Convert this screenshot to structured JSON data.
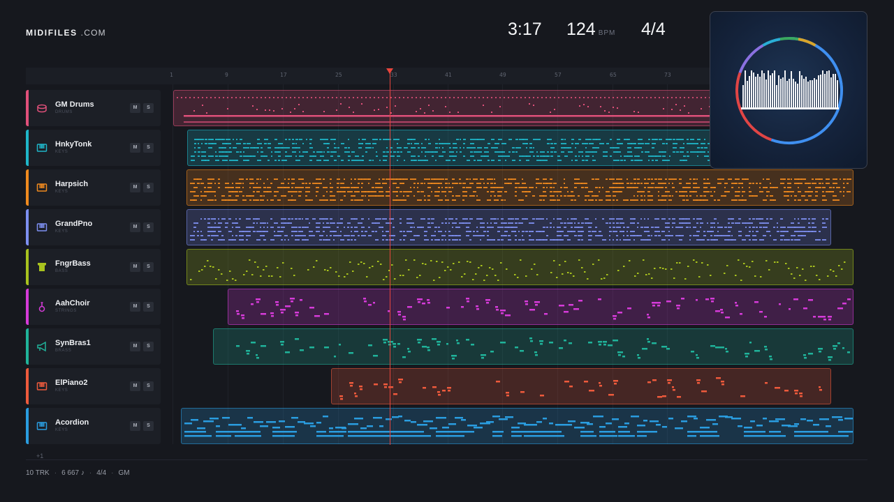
{
  "brand": {
    "name": "MIDIFILES",
    "suffix": ".COM"
  },
  "transport": {
    "time": "3:17",
    "bpm": "124",
    "bpm_unit": "BPM",
    "signature": "4/4"
  },
  "ruler": {
    "ticks": [
      "1",
      "9",
      "17",
      "25",
      "33",
      "41",
      "49",
      "57",
      "65",
      "73"
    ]
  },
  "tracks": [
    {
      "name": "GM Drums",
      "category": "DRUMS",
      "color": "#e0507a",
      "icon": "drum-icon",
      "mute": "M",
      "solo": "S"
    },
    {
      "name": "HnkyTonk",
      "category": "KEYS",
      "color": "#1fb6c9",
      "icon": "keyboard-icon",
      "mute": "M",
      "solo": "S"
    },
    {
      "name": "Harpsich",
      "category": "KEYS",
      "color": "#f08a1e",
      "icon": "keyboard-icon",
      "mute": "M",
      "solo": "S"
    },
    {
      "name": "GrandPno",
      "category": "KEYS",
      "color": "#7d8ff0",
      "icon": "keyboard-icon",
      "mute": "M",
      "solo": "S"
    },
    {
      "name": "FngrBass",
      "category": "BASS",
      "color": "#a8c21e",
      "icon": "bass-icon",
      "mute": "M",
      "solo": "S"
    },
    {
      "name": "AahChoir",
      "category": "STRINGS",
      "color": "#d63bd9",
      "icon": "violin-icon",
      "mute": "M",
      "solo": "S"
    },
    {
      "name": "SynBras1",
      "category": "BRASS",
      "color": "#20b39a",
      "icon": "horn-icon",
      "mute": "M",
      "solo": "S"
    },
    {
      "name": "ElPiano2",
      "category": "KEYS",
      "color": "#ee5a3c",
      "icon": "keyboard-icon",
      "mute": "M",
      "solo": "S"
    },
    {
      "name": "Acordion",
      "category": "KEYS",
      "color": "#2a9de0",
      "icon": "keyboard-icon",
      "mute": "M",
      "solo": "S"
    }
  ],
  "more_tracks": "+1",
  "footer": {
    "tracks": "10 TRK",
    "notes": "6 667 ♪",
    "signature": "4/4",
    "standard": "GM"
  },
  "visualizer": {
    "icon": "audio-visualizer-icon"
  }
}
